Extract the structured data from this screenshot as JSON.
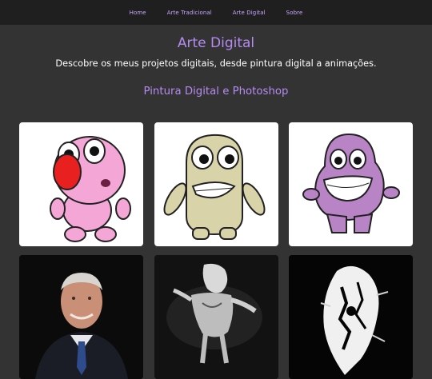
{
  "nav": {
    "items": [
      "Home",
      "Arte Tradicional",
      "Arte Digital",
      "Sobre"
    ]
  },
  "page": {
    "title": "Arte Digital",
    "subtitle": "Descobre os meus projetos digitais, desde pintura digital a animações.",
    "section_title": "Pintura Digital e Photoshop"
  },
  "gallery": [
    {
      "alt": "Pink character with red nose",
      "bg": "#ffffff"
    },
    {
      "alt": "Beige character with teeth",
      "bg": "#ffffff"
    },
    {
      "alt": "Purple smiling character",
      "bg": "#ffffff"
    },
    {
      "alt": "Portrait of smiling man in suit",
      "bg": "#0b0b0b"
    },
    {
      "alt": "Dark figure silhouette",
      "bg": "#0b0b0b"
    },
    {
      "alt": "Abstract white shape on black",
      "bg": "#0b0b0b"
    }
  ],
  "colors": {
    "accent": "#b58bf0",
    "nav_link": "#c9a6ff",
    "nav_bg": "#1f1f1f",
    "page_bg": "#333333"
  }
}
